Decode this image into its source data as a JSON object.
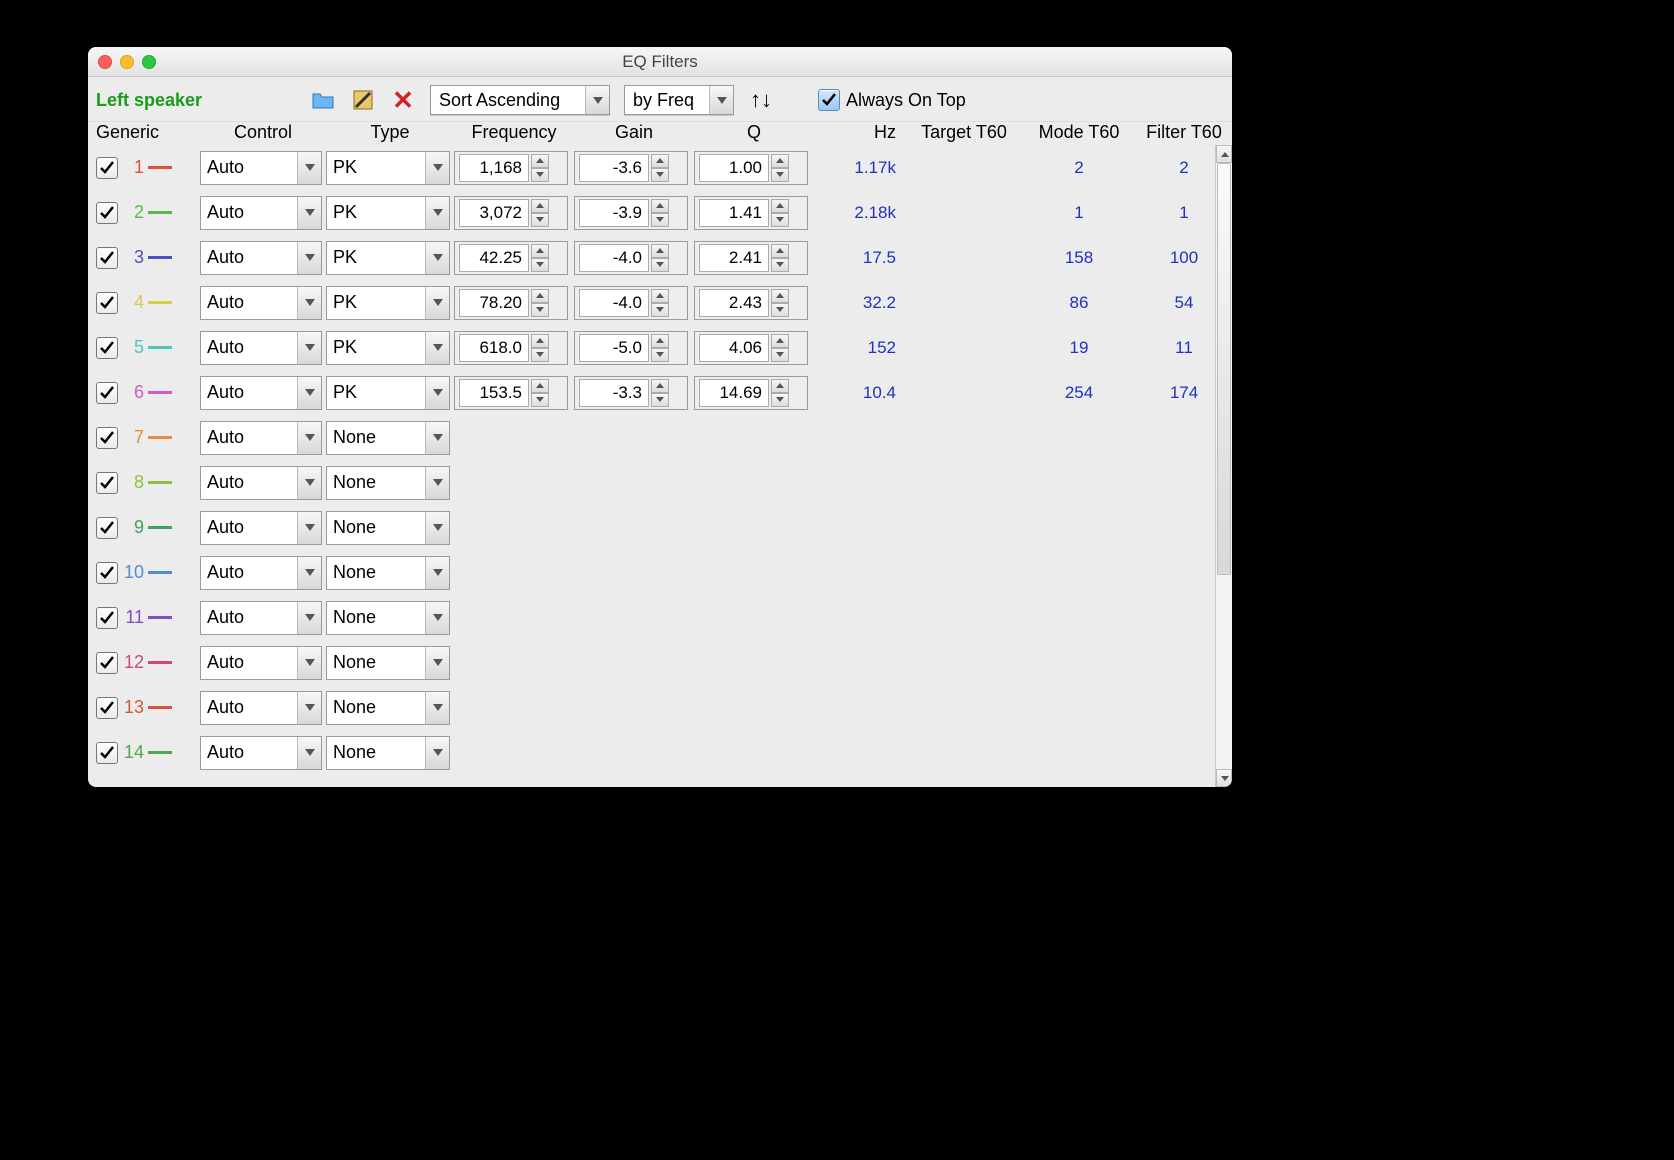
{
  "window": {
    "title": "EQ Filters"
  },
  "toolbar": {
    "speaker_label": "Left speaker",
    "sort_mode": "Sort Ascending",
    "sort_by": "by Freq",
    "always_label": "Always On Top",
    "always_checked": true
  },
  "headers": {
    "generic": "Generic",
    "control": "Control",
    "type": "Type",
    "frequency": "Frequency",
    "gain": "Gain",
    "q": "Q",
    "hz": "Hz",
    "target_t60": "Target T60",
    "mode_t60": "Mode T60",
    "filter_t60": "Filter T60"
  },
  "rows": [
    {
      "n": "1",
      "color": "#e0503c",
      "control": "Auto",
      "type": "PK",
      "freq": "1,168",
      "gain": "-3.6",
      "q": "1.00",
      "hz": "1.17k",
      "target": "",
      "mode": "2",
      "filter": "2"
    },
    {
      "n": "2",
      "color": "#58b84a",
      "control": "Auto",
      "type": "PK",
      "freq": "3,072",
      "gain": "-3.9",
      "q": "1.41",
      "hz": "2.18k",
      "target": "",
      "mode": "1",
      "filter": "1"
    },
    {
      "n": "3",
      "color": "#4a52c2",
      "control": "Auto",
      "type": "PK",
      "freq": "42.25",
      "gain": "-4.0",
      "q": "2.41",
      "hz": "17.5",
      "target": "",
      "mode": "158",
      "filter": "100"
    },
    {
      "n": "4",
      "color": "#d8cc4e",
      "control": "Auto",
      "type": "PK",
      "freq": "78.20",
      "gain": "-4.0",
      "q": "2.43",
      "hz": "32.2",
      "target": "",
      "mode": "86",
      "filter": "54"
    },
    {
      "n": "5",
      "color": "#4dc4c4",
      "control": "Auto",
      "type": "PK",
      "freq": "618.0",
      "gain": "-5.0",
      "q": "4.06",
      "hz": "152",
      "target": "",
      "mode": "19",
      "filter": "11"
    },
    {
      "n": "6",
      "color": "#d858c0",
      "control": "Auto",
      "type": "PK",
      "freq": "153.5",
      "gain": "-3.3",
      "q": "14.69",
      "hz": "10.4",
      "target": "",
      "mode": "254",
      "filter": "174"
    },
    {
      "n": "7",
      "color": "#e09038",
      "control": "Auto",
      "type": "None"
    },
    {
      "n": "8",
      "color": "#90c040",
      "control": "Auto",
      "type": "None"
    },
    {
      "n": "9",
      "color": "#40a060",
      "control": "Auto",
      "type": "None"
    },
    {
      "n": "10",
      "color": "#5090d0",
      "control": "Auto",
      "type": "None"
    },
    {
      "n": "11",
      "color": "#8050c0",
      "control": "Auto",
      "type": "None"
    },
    {
      "n": "12",
      "color": "#d04878",
      "control": "Auto",
      "type": "None"
    },
    {
      "n": "13",
      "color": "#d05838",
      "control": "Auto",
      "type": "None"
    },
    {
      "n": "14",
      "color": "#50a850",
      "control": "Auto",
      "type": "None"
    }
  ]
}
